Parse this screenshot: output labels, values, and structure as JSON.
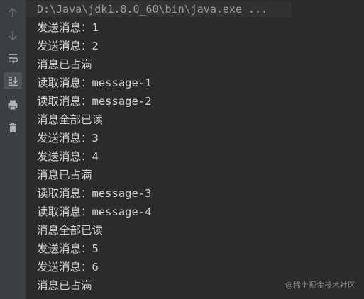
{
  "toolbar": {
    "buttons": [
      {
        "icon": "arrow-up-icon",
        "label": "Up the Stack Trace"
      },
      {
        "icon": "arrow-down-icon",
        "label": "Down the Stack Trace"
      },
      {
        "icon": "soft-wrap-icon",
        "label": "Soft-Wrap"
      },
      {
        "icon": "scroll-to-end-icon",
        "label": "Scroll to End",
        "active": true
      },
      {
        "icon": "print-icon",
        "label": "Print"
      },
      {
        "icon": "trash-icon",
        "label": "Clear All"
      }
    ]
  },
  "console": {
    "command": "D:\\Java\\jdk1.8.0_60\\bin\\java.exe ...",
    "lines": [
      "发送消息：1",
      "发送消息：2",
      "消息已占满",
      "读取消息：message-1",
      "读取消息：message-2",
      "消息全部已读",
      "发送消息：3",
      "发送消息：4",
      "消息已占满",
      "读取消息：message-3",
      "读取消息：message-4",
      "消息全部已读",
      "发送消息：5",
      "发送消息：6",
      "消息已占满"
    ]
  },
  "watermark": "@稀土掘金技术社区",
  "colors": {
    "background": "#2b2b2b",
    "gutter": "#3c3f41",
    "text": "#d4d4d4",
    "command_text": "#9e9e9e"
  }
}
